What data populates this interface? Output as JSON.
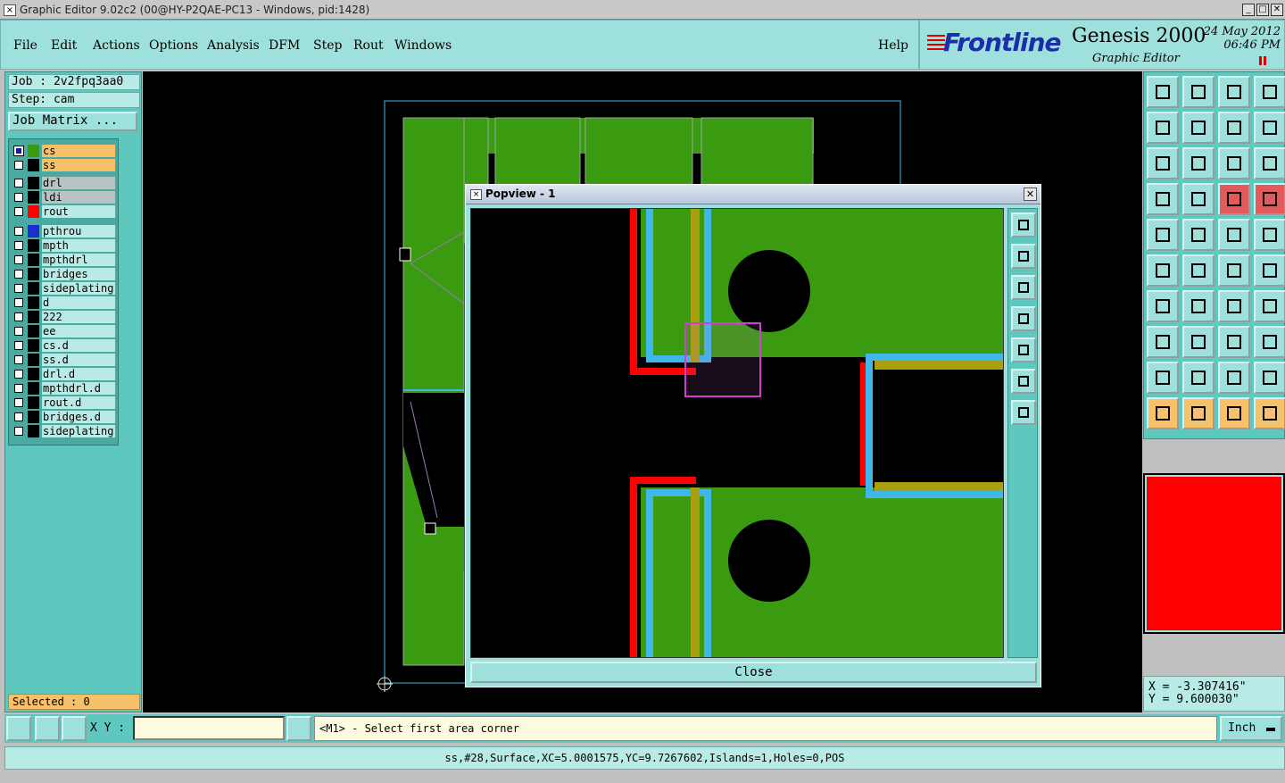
{
  "window": {
    "title": "Graphic Editor 9.02c2 (00@HY-P2QAE-PC13 - Windows, pid:1428)",
    "controls": [
      "_",
      "□",
      "✕"
    ]
  },
  "menu": {
    "file": "File",
    "edit": "Edit",
    "actions": "Actions",
    "options": "Options",
    "analysis": "Analysis",
    "dfm": "DFM",
    "step": "Step",
    "rout": "Rout",
    "windows": "Windows",
    "help": "Help"
  },
  "brand": {
    "logo": "Frontline",
    "product": "Genesis 2000",
    "subtitle": "Graphic Editor",
    "date": "24 May 2012",
    "time": "06:46 PM"
  },
  "job": {
    "job_label": "Job : 2v2fpq3aa0",
    "step_label": "Step: cam",
    "job_matrix_button": "Job Matrix ...",
    "selected": "Selected : 0"
  },
  "layers": [
    {
      "name": "cs",
      "checked": true,
      "color": "#3a9a10",
      "style": "orange"
    },
    {
      "name": "ss",
      "checked": false,
      "color": "#000000",
      "style": "orange"
    },
    {
      "name": "drl",
      "checked": false,
      "color": "#000000",
      "style": "gray"
    },
    {
      "name": "ldi",
      "checked": false,
      "color": "#000000",
      "style": "gray"
    },
    {
      "name": "rout",
      "checked": false,
      "color": "#fe0000",
      "style": "light"
    },
    {
      "name": "pthrou",
      "checked": false,
      "color": "#1a2fd0",
      "style": "plain"
    },
    {
      "name": "mpth",
      "checked": false,
      "color": "#000000",
      "style": "plain"
    },
    {
      "name": "mpthdrl",
      "checked": false,
      "color": "#000000",
      "style": "plain"
    },
    {
      "name": "bridges",
      "checked": false,
      "color": "#000000",
      "style": "plain"
    },
    {
      "name": "sideplating",
      "checked": false,
      "color": "#000000",
      "style": "plain"
    },
    {
      "name": "d",
      "checked": false,
      "color": "#000000",
      "style": "plain"
    },
    {
      "name": "222",
      "checked": false,
      "color": "#000000",
      "style": "plain"
    },
    {
      "name": "ee",
      "checked": false,
      "color": "#000000",
      "style": "plain"
    },
    {
      "name": "cs.d",
      "checked": false,
      "color": "#000000",
      "style": "plain"
    },
    {
      "name": "ss.d",
      "checked": false,
      "color": "#000000",
      "style": "plain"
    },
    {
      "name": "drl.d",
      "checked": false,
      "color": "#000000",
      "style": "plain"
    },
    {
      "name": "mpthdrl.d",
      "checked": false,
      "color": "#000000",
      "style": "plain"
    },
    {
      "name": "rout.d",
      "checked": false,
      "color": "#000000",
      "style": "plain"
    },
    {
      "name": "bridges.d",
      "checked": false,
      "color": "#000000",
      "style": "plain"
    },
    {
      "name": "sideplating",
      "checked": false,
      "color": "#000000",
      "style": "plain"
    }
  ],
  "popview": {
    "title": "Popview - 1",
    "close_label": "Close",
    "close_x": "✕"
  },
  "coords": {
    "x": "X = -3.307416\"",
    "y": "Y = 9.600030\""
  },
  "bottom": {
    "xy_label": "X Y :",
    "xy_value": "",
    "prompt": "<M1> - Select first area corner",
    "units": "Inch",
    "status": "ss,#28,Surface,XC=5.0001575,YC=9.7267602,Islands=1,Holes=0,POS"
  },
  "colors": {
    "panel": "#5ec7be",
    "menu": "#9ee0dc",
    "copper": "#3a9a10",
    "rout": "#fe0000",
    "highlight": "#f7c16a",
    "cyan_outline": "#3fb7ea"
  }
}
